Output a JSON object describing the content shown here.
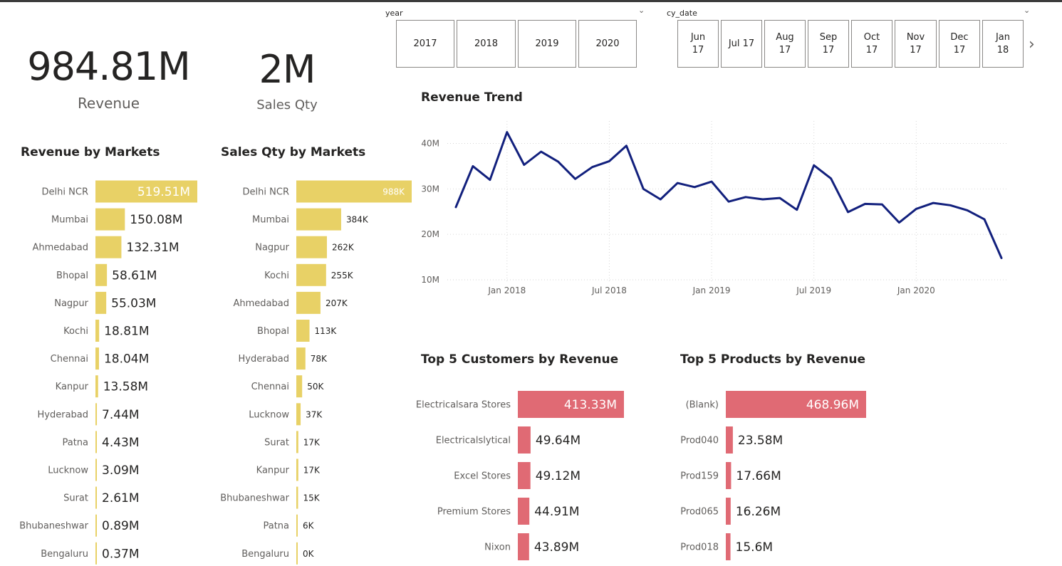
{
  "kpis": {
    "revenue": {
      "value": "984.81M",
      "label": "Revenue"
    },
    "sales_qty": {
      "value": "2M",
      "label": "Sales Qty"
    }
  },
  "slicers": {
    "year": {
      "label": "year",
      "items": [
        "2017",
        "2018",
        "2019",
        "2020"
      ]
    },
    "cy_date": {
      "label": "cy_date",
      "items": [
        [
          "Jun",
          "17"
        ],
        [
          "Jul 17"
        ],
        [
          "Aug",
          "17"
        ],
        [
          "Sep",
          "17"
        ],
        [
          "Oct",
          "17"
        ],
        [
          "Nov",
          "17"
        ],
        [
          "Dec",
          "17"
        ],
        [
          "Jan",
          "18"
        ]
      ]
    }
  },
  "colors": {
    "market_bar": "#E8D166",
    "top5_bar": "#E06A74",
    "trend_line": "#12207D"
  },
  "chart_data": [
    {
      "id": "revenue_by_markets",
      "type": "bar",
      "orientation": "horizontal",
      "title": "Revenue by Markets",
      "categories": [
        "Delhi NCR",
        "Mumbai",
        "Ahmedabad",
        "Bhopal",
        "Nagpur",
        "Kochi",
        "Chennai",
        "Kanpur",
        "Hyderabad",
        "Patna",
        "Lucknow",
        "Surat",
        "Bhubaneshwar",
        "Bengaluru"
      ],
      "values": [
        519.51,
        150.08,
        132.31,
        58.61,
        55.03,
        18.81,
        18.04,
        13.58,
        7.44,
        4.43,
        3.09,
        2.61,
        0.89,
        0.37
      ],
      "data_labels": [
        "519.51M",
        "150.08M",
        "132.31M",
        "58.61M",
        "55.03M",
        "18.81M",
        "18.04M",
        "13.58M",
        "7.44M",
        "4.43M",
        "3.09M",
        "2.61M",
        "0.89M",
        "0.37M"
      ],
      "unit": "M"
    },
    {
      "id": "sales_qty_by_markets",
      "type": "bar",
      "orientation": "horizontal",
      "title": "Sales Qty by Markets",
      "categories": [
        "Delhi NCR",
        "Mumbai",
        "Nagpur",
        "Kochi",
        "Ahmedabad",
        "Bhopal",
        "Hyderabad",
        "Chennai",
        "Lucknow",
        "Surat",
        "Kanpur",
        "Bhubaneshwar",
        "Patna",
        "Bengaluru"
      ],
      "values": [
        988,
        384,
        262,
        255,
        207,
        113,
        78,
        50,
        37,
        17,
        17,
        15,
        6,
        0
      ],
      "data_labels": [
        "988K",
        "384K",
        "262K",
        "255K",
        "207K",
        "113K",
        "78K",
        "50K",
        "37K",
        "17K",
        "17K",
        "15K",
        "6K",
        "0K"
      ],
      "unit": "K"
    },
    {
      "id": "revenue_trend",
      "type": "line",
      "title": "Revenue Trend",
      "x": [
        "2017-10",
        "2017-11",
        "2017-12",
        "2018-01",
        "2018-02",
        "2018-03",
        "2018-04",
        "2018-05",
        "2018-06",
        "2018-07",
        "2018-08",
        "2018-09",
        "2018-10",
        "2018-11",
        "2018-12",
        "2019-01",
        "2019-02",
        "2019-03",
        "2019-04",
        "2019-05",
        "2019-06",
        "2019-07",
        "2019-08",
        "2019-09",
        "2019-10",
        "2019-11",
        "2019-12",
        "2020-01",
        "2020-02",
        "2020-03",
        "2020-04",
        "2020-05",
        "2020-06"
      ],
      "series": [
        {
          "values": [
            26.0,
            35.0,
            32.0,
            42.5,
            35.3,
            38.2,
            36.0,
            32.2,
            34.8,
            36.1,
            39.5,
            30.0,
            27.7,
            31.3,
            30.4,
            31.6,
            27.2,
            28.2,
            27.7,
            28.0,
            25.4,
            35.2,
            32.3,
            24.9,
            26.7,
            26.6,
            22.6,
            25.6,
            26.9,
            26.4,
            25.3,
            23.3,
            14.8
          ]
        }
      ],
      "x_tick_labels": [
        "Jan 2018",
        "Jul 2018",
        "Jan 2019",
        "Jul 2019",
        "Jan 2020"
      ],
      "y_tick_labels": [
        "10M",
        "20M",
        "30M",
        "40M"
      ],
      "ylim": [
        10,
        44
      ],
      "y_unit": "M",
      "grid": true
    },
    {
      "id": "top5_customers",
      "type": "bar",
      "orientation": "horizontal",
      "title": "Top 5 Customers by Revenue",
      "categories": [
        "Electricalsara Stores",
        "Electricalslytical",
        "Excel Stores",
        "Premium Stores",
        "Nixon"
      ],
      "values": [
        413.33,
        49.64,
        49.12,
        44.91,
        43.89
      ],
      "data_labels": [
        "413.33M",
        "49.64M",
        "49.12M",
        "44.91M",
        "43.89M"
      ],
      "unit": "M"
    },
    {
      "id": "top5_products",
      "type": "bar",
      "orientation": "horizontal",
      "title": "Top 5 Products by Revenue",
      "categories": [
        "(Blank)",
        "Prod040",
        "Prod159",
        "Prod065",
        "Prod018"
      ],
      "values": [
        468.96,
        23.58,
        17.66,
        16.26,
        15.6
      ],
      "data_labels": [
        "468.96M",
        "23.58M",
        "17.66M",
        "16.26M",
        "15.6M"
      ],
      "unit": "M"
    }
  ]
}
